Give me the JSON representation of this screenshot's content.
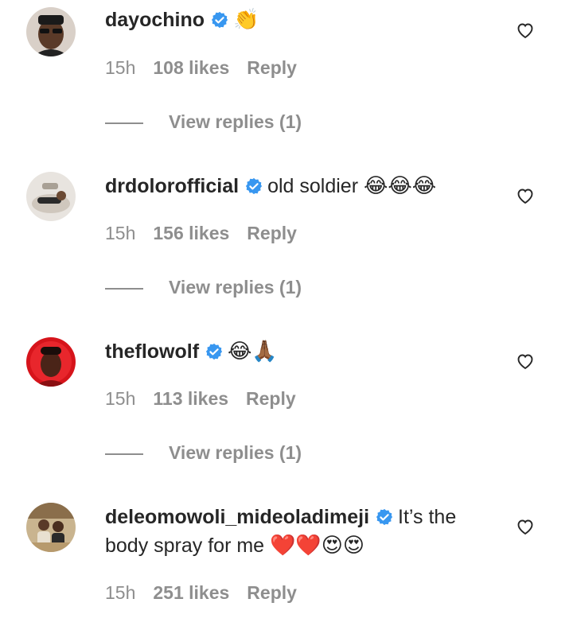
{
  "comments": [
    {
      "username": "dayochino",
      "text": "",
      "emoji": "👏",
      "time": "15h",
      "likes": "108 likes",
      "reply": "Reply",
      "view_replies": "View replies (1)"
    },
    {
      "username": "drdolorofficial",
      "text": "old soldier",
      "emoji": "😂😂😂",
      "time": "15h",
      "likes": "156 likes",
      "reply": "Reply",
      "view_replies": "View replies (1)"
    },
    {
      "username": "theflowolf",
      "text": "",
      "emoji": "😂🙏🏾",
      "time": "15h",
      "likes": "113 likes",
      "reply": "Reply",
      "view_replies": "View replies (1)"
    },
    {
      "username": "deleomowoli_mideoladimeji",
      "text": "It’s the body spray for me",
      "emoji": "❤️❤️😍😍",
      "time": "15h",
      "likes": "251 likes",
      "reply": "Reply"
    }
  ],
  "colors": {
    "verified": "#3897f0",
    "muted": "#8e8e8e",
    "text": "#262626"
  },
  "icons": {
    "verified": "verified-badge-icon",
    "heart": "heart-outline-icon"
  }
}
